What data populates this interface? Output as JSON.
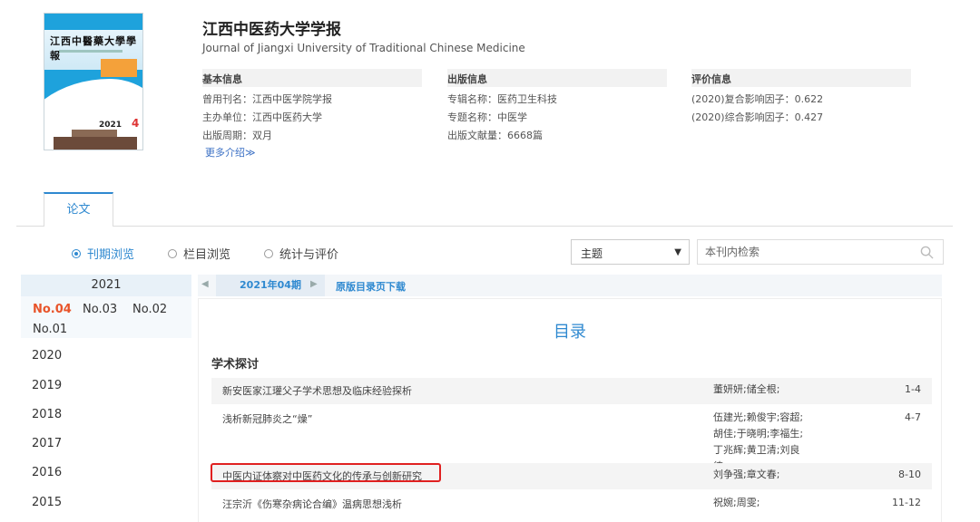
{
  "journal": {
    "title": "江西中医药大学学报",
    "english_title": "Journal of Jiangxi University of Traditional Chinese Medicine",
    "cover": {
      "title": "江西中醫藥大學學報",
      "year": "2021",
      "issue": "4"
    }
  },
  "info": {
    "basic": {
      "heading": "基本信息",
      "rows": [
        "曾用刊名：江西中医学院学报",
        "主办单位：江西中医药大学",
        "出版周期：双月"
      ],
      "more": "更多介绍≫"
    },
    "publish": {
      "heading": "出版信息",
      "rows": [
        "专辑名称：医药卫生科技",
        "专题名称：中医学",
        "出版文献量：6668篇"
      ]
    },
    "evaluate": {
      "heading": "评价信息",
      "rows": [
        "(2020)复合影响因子：0.622",
        "(2020)综合影响因子：0.427"
      ]
    }
  },
  "tabs": {
    "paper": "论文"
  },
  "browse": {
    "options": [
      "刊期浏览",
      "栏目浏览",
      "统计与评价"
    ],
    "select_value": "主题",
    "search_placeholder": "本刊内检索"
  },
  "years": {
    "current": "2021",
    "issues": [
      "No.04",
      "No.03",
      "No.02",
      "No.01"
    ],
    "others": [
      "2020",
      "2019",
      "2018",
      "2017",
      "2016",
      "2015"
    ]
  },
  "issue_nav": {
    "current": "2021年04期",
    "download": "原版目录页下载"
  },
  "toc": {
    "title": "目录",
    "section": "学术探讨",
    "articles": [
      {
        "title": "新安医家江瓘父子学术思想及临床经验探析",
        "authors": "董妍妍;储全根;",
        "pages": "1-4"
      },
      {
        "title": "浅析新冠肺炎之“燥”",
        "authors": "伍建光;赖俊宇;容超;胡佳;于晓明;李福生;丁兆辉;黄卫清;刘良徛;",
        "pages": "4-7"
      },
      {
        "title": "中医内证体察对中医药文化的传承与创新研究",
        "authors": "刘争强;章文春;",
        "pages": "8-10"
      },
      {
        "title": "汪宗沂《伤寒杂病论合编》温病思想浅析",
        "authors": "祝婉;周雯;",
        "pages": "11-12"
      }
    ]
  },
  "colors": {
    "accent": "#2f89d0",
    "active_issue": "#e8542a",
    "highlight_box": "#e02020"
  }
}
